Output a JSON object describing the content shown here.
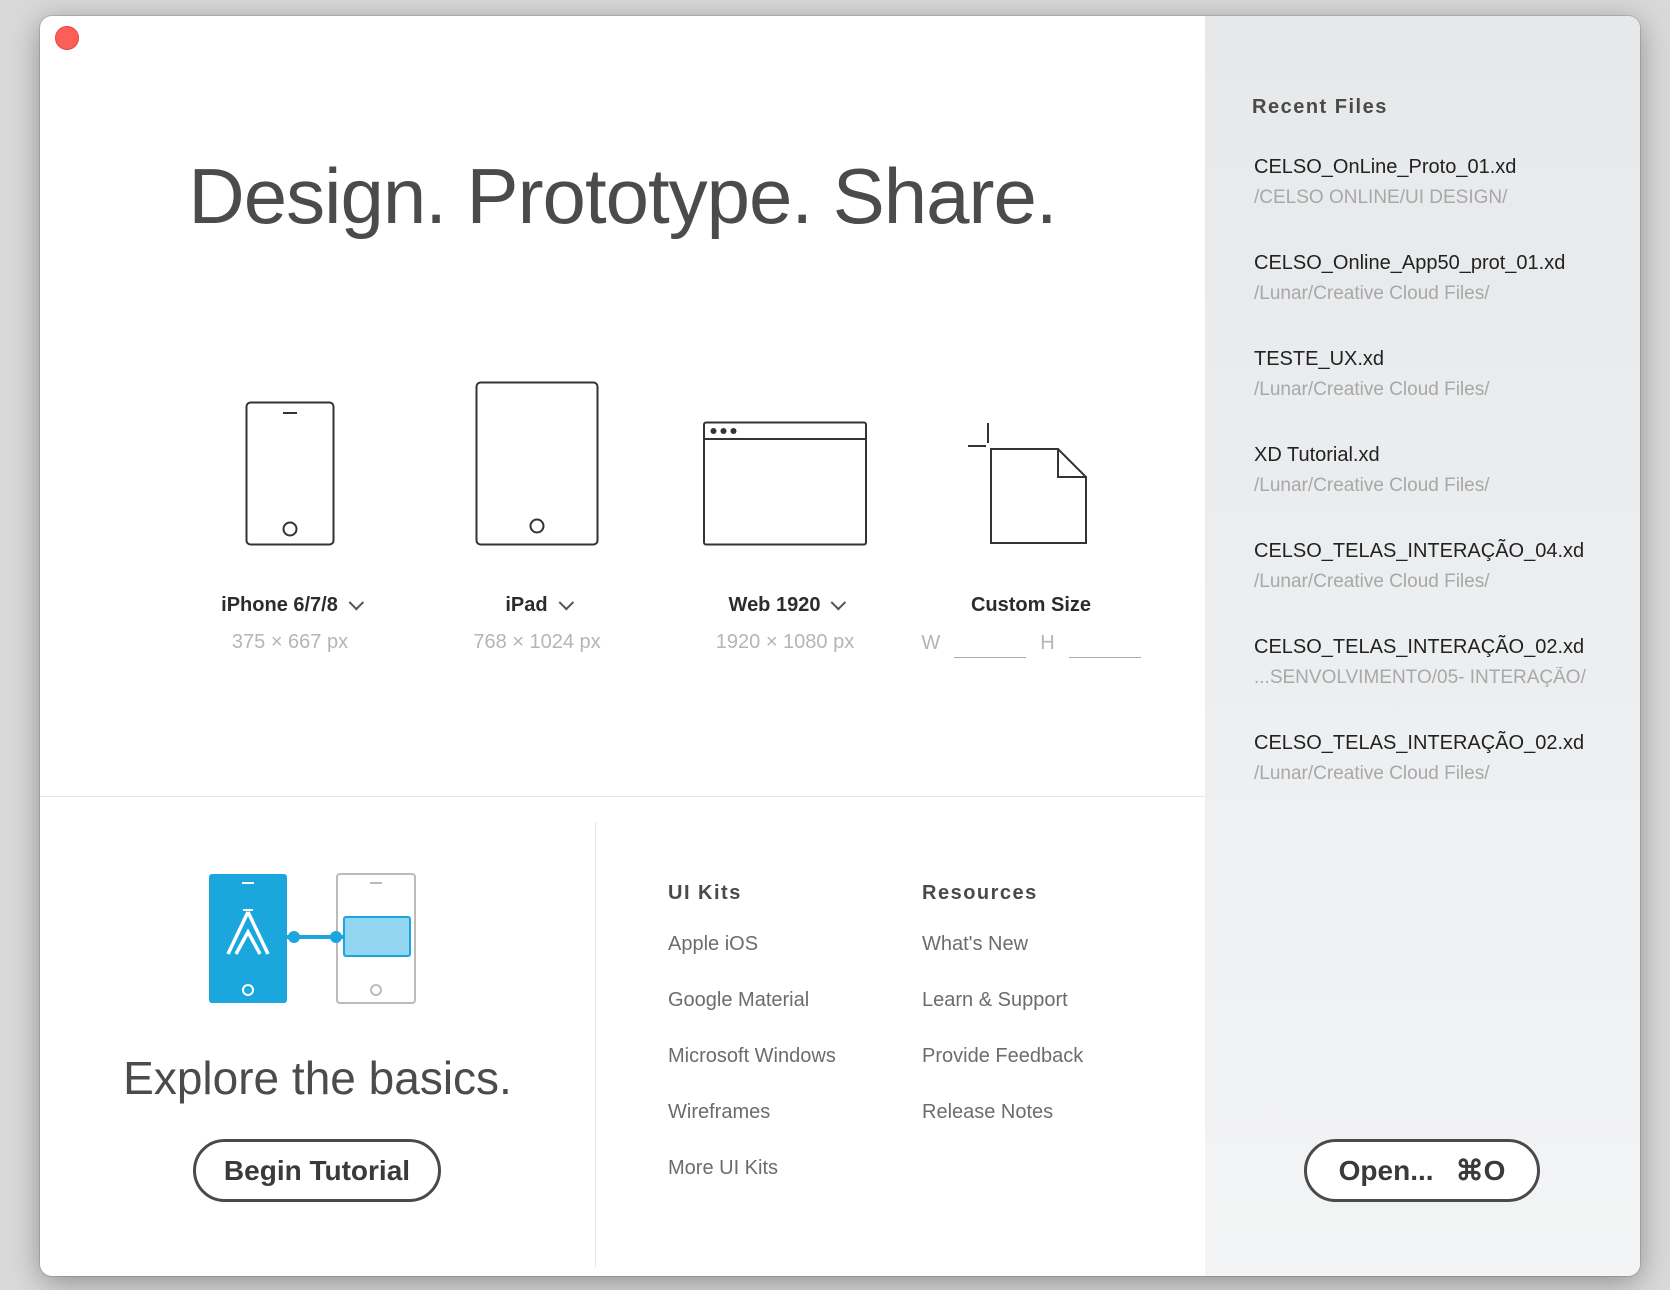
{
  "headline": "Design. Prototype. Share.",
  "presets": [
    {
      "label": "iPhone 6/7/8",
      "dims": "375 × 667 px",
      "icon": "iphone-icon"
    },
    {
      "label": "iPad",
      "dims": "768 × 1024 px",
      "icon": "ipad-icon"
    },
    {
      "label": "Web 1920",
      "dims": "1920 × 1080 px",
      "icon": "browser-window-icon"
    }
  ],
  "custom": {
    "label": "Custom Size",
    "w_label": "W",
    "h_label": "H",
    "w_value": "",
    "h_value": "",
    "icon": "blank-document-icon"
  },
  "explore": {
    "text": "Explore the basics.",
    "button": "Begin Tutorial",
    "accent": "#1ba7de",
    "light_accent": "#93d6f2"
  },
  "ui_kits": {
    "heading": "UI Kits",
    "items": [
      "Apple iOS",
      "Google Material",
      "Microsoft Windows",
      "Wireframes",
      "More UI Kits"
    ]
  },
  "resources": {
    "heading": "Resources",
    "items": [
      "What's New",
      "Learn & Support",
      "Provide Feedback",
      "Release Notes"
    ]
  },
  "recent": {
    "heading": "Recent Files",
    "files": [
      {
        "name": "CELSO_OnLine_Proto_01.xd",
        "path": "/CELSO ONLINE/UI DESIGN/"
      },
      {
        "name": "CELSO_Online_App50_prot_01.xd",
        "path": "/Lunar/Creative Cloud Files/"
      },
      {
        "name": "TESTE_UX.xd",
        "path": "/Lunar/Creative Cloud Files/"
      },
      {
        "name": "XD Tutorial.xd",
        "path": "/Lunar/Creative Cloud Files/"
      },
      {
        "name": "CELSO_TELAS_INTERAÇÃO_04.xd",
        "path": "/Lunar/Creative Cloud Files/"
      },
      {
        "name": "CELSO_TELAS_INTERAÇÃO_02.xd",
        "path": "...SENVOLVIMENTO/05- INTERAÇÃO/"
      },
      {
        "name": "CELSO_TELAS_INTERAÇÃO_02.xd",
        "path": "/Lunar/Creative Cloud Files/"
      }
    ]
  },
  "open_button": {
    "label": "Open...",
    "shortcut": "⌘O"
  },
  "window_controls": {
    "close_color": "#fc5f57"
  }
}
